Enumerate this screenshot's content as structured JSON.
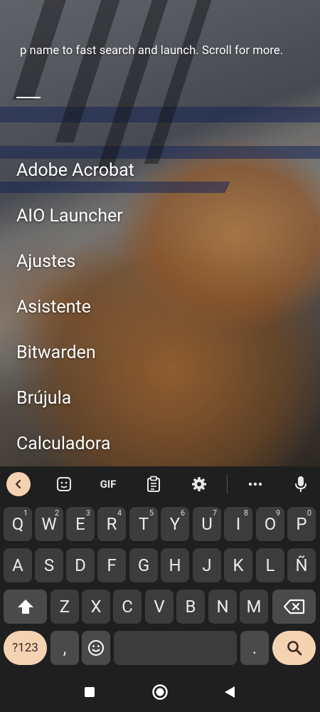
{
  "launcher": {
    "hint": "p name to fast search and launch. Scroll for more.",
    "apps": [
      "Adobe Acrobat",
      "AIO Launcher",
      "Ajustes",
      "Asistente",
      "Bitwarden",
      "Brújula",
      "Calculadora"
    ]
  },
  "keyboard": {
    "toolbar": {
      "back_icon": "chevron-left-icon",
      "sticker_icon": "sticker-icon",
      "gif_label": "GIF",
      "clipboard_icon": "clipboard-icon",
      "settings_icon": "gear-icon",
      "more_icon": "more-horizontal-icon",
      "mic_icon": "microphone-icon"
    },
    "row1": [
      {
        "key": "Q",
        "num": "1"
      },
      {
        "key": "W",
        "num": "2"
      },
      {
        "key": "E",
        "num": "3"
      },
      {
        "key": "R",
        "num": "4"
      },
      {
        "key": "T",
        "num": "5"
      },
      {
        "key": "Y",
        "num": "6"
      },
      {
        "key": "U",
        "num": "7"
      },
      {
        "key": "I",
        "num": "8"
      },
      {
        "key": "O",
        "num": "9"
      },
      {
        "key": "P",
        "num": "0"
      }
    ],
    "row2": [
      "A",
      "S",
      "D",
      "F",
      "G",
      "H",
      "J",
      "K",
      "L",
      "Ñ"
    ],
    "row3": [
      "Z",
      "X",
      "C",
      "V",
      "B",
      "N",
      "M"
    ],
    "symbols_label": "?123",
    "comma_label": ",",
    "period_label": ".",
    "emoji_icon": "emoji-icon",
    "search_icon": "search-icon",
    "shift_icon": "shift-icon",
    "backspace_icon": "backspace-icon",
    "accent_color": "#f5d2b2"
  },
  "navbar": {
    "recents_icon": "square-icon",
    "home_icon": "circle-icon",
    "back_icon": "triangle-back-icon"
  }
}
